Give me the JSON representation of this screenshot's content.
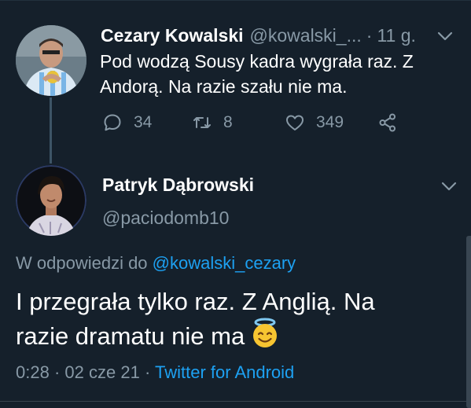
{
  "tweet1": {
    "name": "Cezary Kowalski",
    "handle": "@kowalski_...",
    "dot": "·",
    "time": "11 g.",
    "text_line1": "Pod wodzą Sousy kadra wygrała raz. Z",
    "text_line2": "Andorą. Na razie szału nie ma.",
    "replies": "34",
    "retweets": "8",
    "likes": "349"
  },
  "tweet2": {
    "name": "Patryk Dąbrowski",
    "handle": "@paciodomb10",
    "reply_prefix": "W odpowiedzi do",
    "reply_mention": "@kowalski_cezary",
    "text_line1": "I przegrała tylko raz. Z Anglią. Na",
    "text_line2": "razie dramatu nie ma",
    "time": "0:28",
    "sep1": "·",
    "date": "02 cze 21",
    "sep2": "·",
    "source": "Twitter for Android"
  },
  "colors": {
    "background": "#15202b",
    "secondary_text": "#8899a6",
    "accent": "#1da1f2"
  },
  "icons": {
    "reply": "comment-icon",
    "retweet": "retweet-icon",
    "like": "heart-icon",
    "share": "share-icon",
    "menu": "chevron-down-icon",
    "emoji": "smiling-face-with-halo-emoji"
  }
}
